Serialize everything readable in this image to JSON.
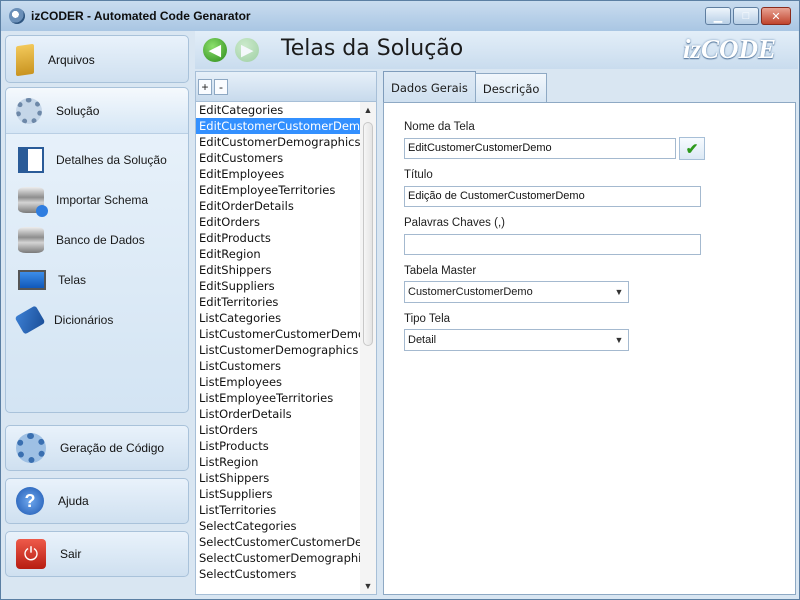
{
  "window": {
    "title": "izCODER - Automated Code Genarator"
  },
  "sidebar": {
    "arquivos": "Arquivos",
    "solucao": "Solução",
    "sub_items": [
      {
        "label": "Detalhes da Solução",
        "icon": "details-window-icon"
      },
      {
        "label": "Importar Schema",
        "icon": "import-database-icon"
      },
      {
        "label": "Banco de Dados",
        "icon": "database-icon"
      },
      {
        "label": "Telas",
        "icon": "monitor-icon"
      },
      {
        "label": "Dicionários",
        "icon": "book-icon"
      }
    ],
    "geracao": "Geração de Código",
    "ajuda": "Ajuda",
    "sair": "Sair"
  },
  "header": {
    "title": "Telas da Solução",
    "logo": "izCODE"
  },
  "list": {
    "add_label": "+",
    "remove_label": "-",
    "selected_index": 1,
    "items": [
      "EditCategories",
      "EditCustomerCustomerDemo",
      "EditCustomerDemographics",
      "EditCustomers",
      "EditEmployees",
      "EditEmployeeTerritories",
      "EditOrderDetails",
      "EditOrders",
      "EditProducts",
      "EditRegion",
      "EditShippers",
      "EditSuppliers",
      "EditTerritories",
      "ListCategories",
      "ListCustomerCustomerDemo",
      "ListCustomerDemographics",
      "ListCustomers",
      "ListEmployees",
      "ListEmployeeTerritories",
      "ListOrderDetails",
      "ListOrders",
      "ListProducts",
      "ListRegion",
      "ListShippers",
      "ListSuppliers",
      "ListTerritories",
      "SelectCategories",
      "SelectCustomerCustomerDemo",
      "SelectCustomerDemographics",
      "SelectCustomers"
    ]
  },
  "tabs": {
    "dados_gerais": "Dados Gerais",
    "descricao": "Descrição"
  },
  "form": {
    "nome_label": "Nome da Tela",
    "nome_value": "EditCustomerCustomerDemo",
    "titulo_label": "Título",
    "titulo_value": "Edição de CustomerCustomerDemo",
    "palavras_label": "Palavras Chaves (,)",
    "palavras_value": "",
    "tabela_label": "Tabela Master",
    "tabela_value": "CustomerCustomerDemo",
    "tipo_label": "Tipo Tela",
    "tipo_value": "Detail"
  },
  "colors": {
    "selection": "#3390ff",
    "accent": "#2e9a1d"
  }
}
